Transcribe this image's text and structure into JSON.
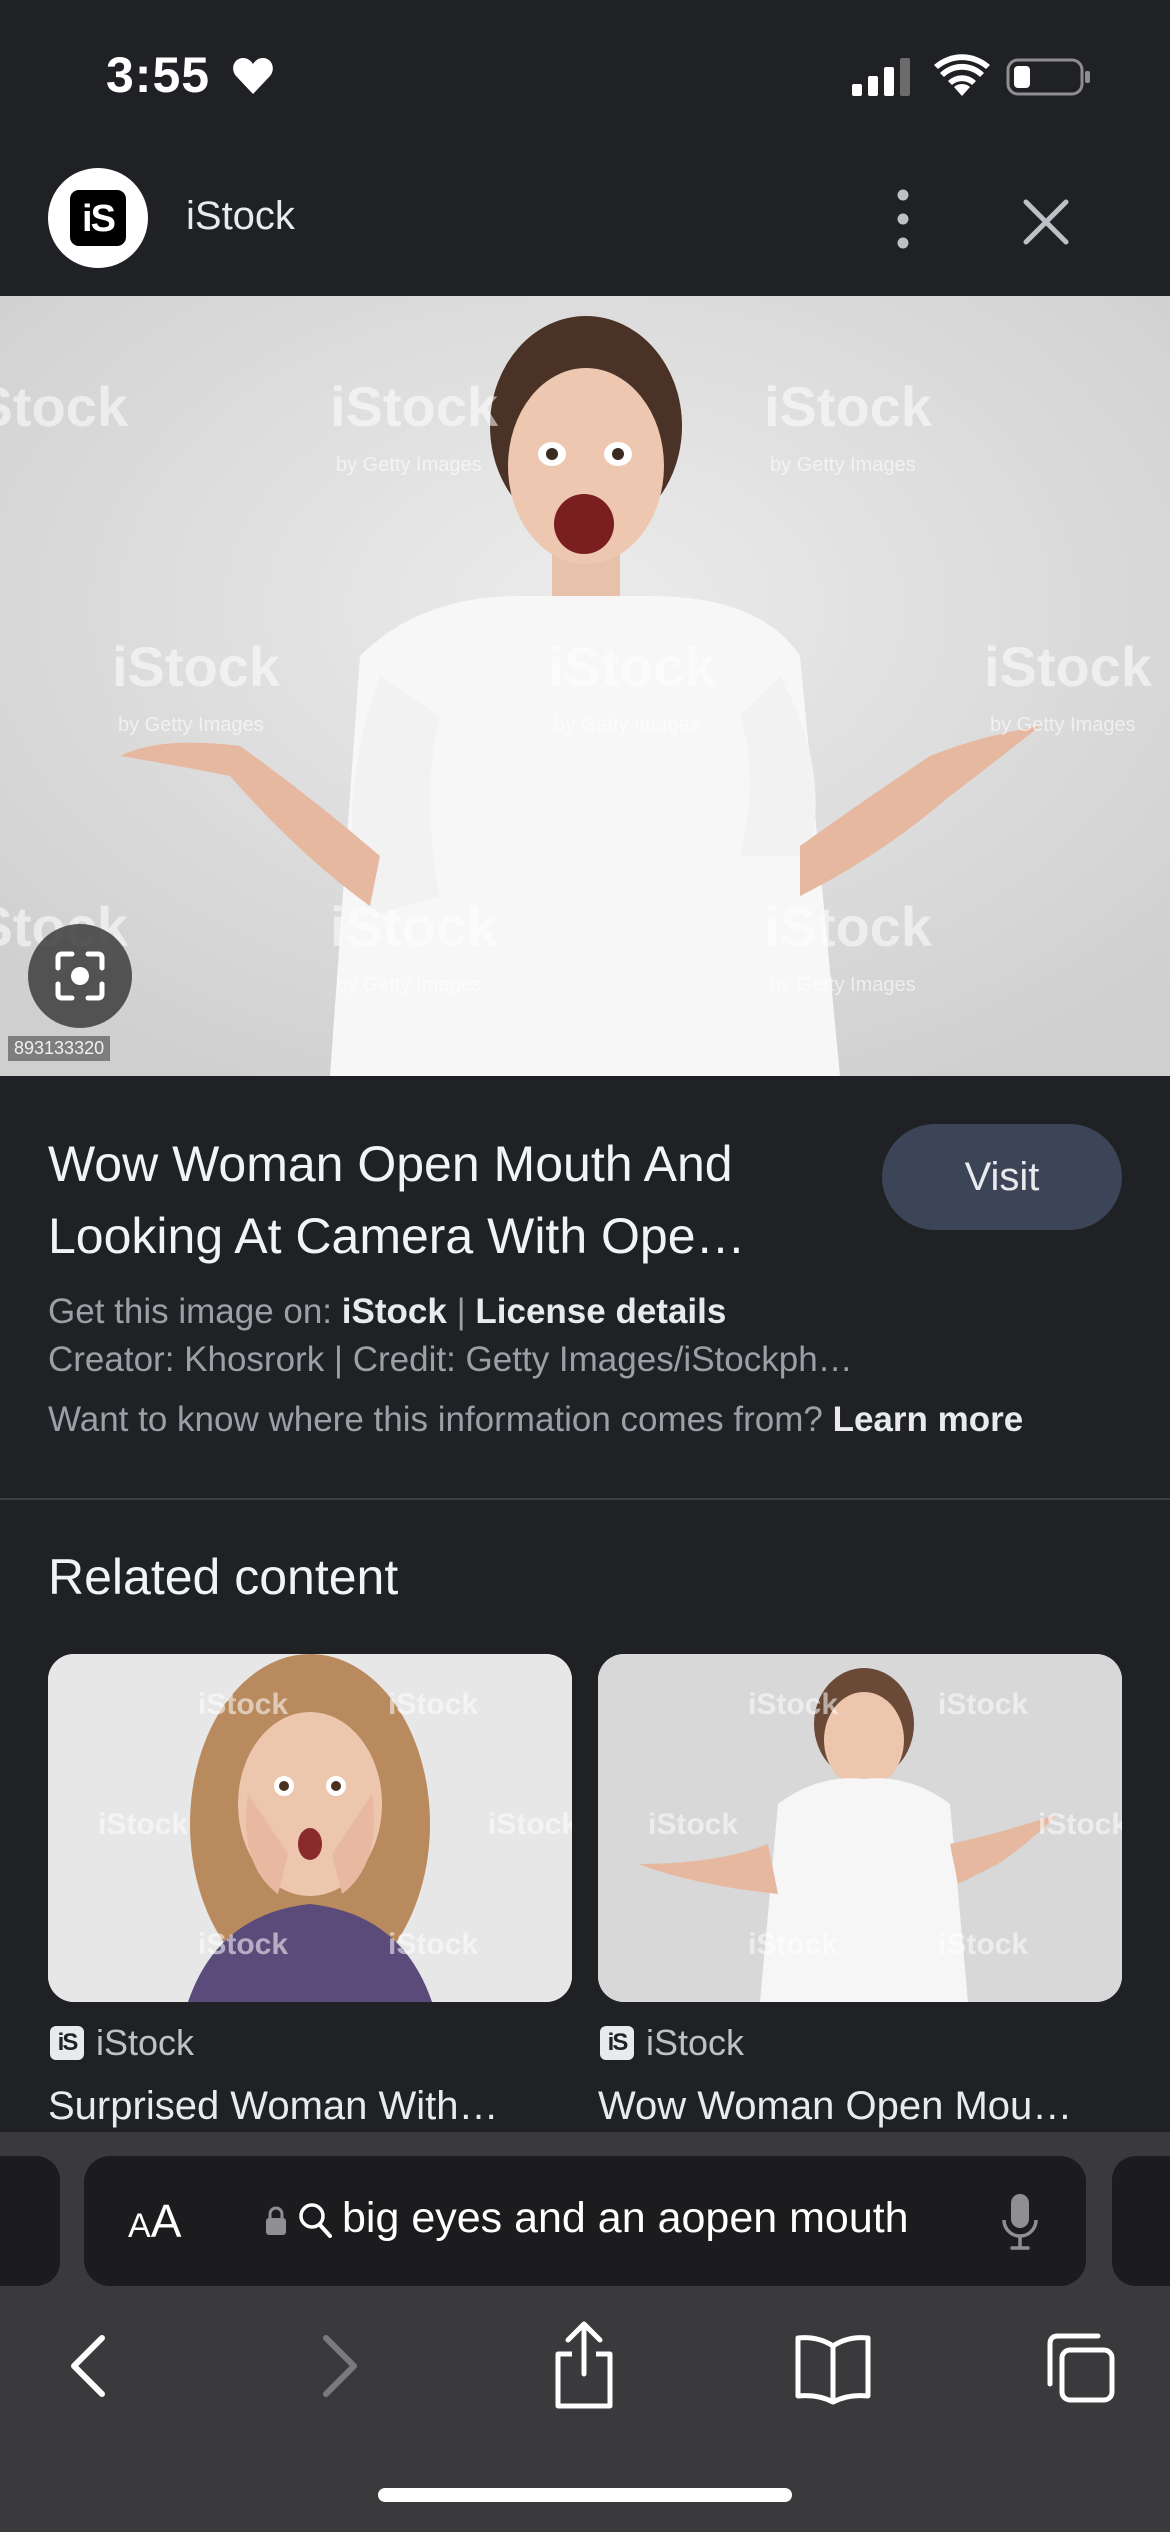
{
  "status_bar": {
    "time": "3:55",
    "icons": [
      "heart-icon",
      "cellular-signal-icon",
      "wifi-icon",
      "battery-icon"
    ]
  },
  "site_header": {
    "logo_text": "iS",
    "site_name": "iStock",
    "icons": [
      "more-vertical-icon",
      "close-icon"
    ]
  },
  "hero_image": {
    "description_icon": "lens-icon",
    "image_id": "893133320",
    "watermark": "iStock",
    "watermark_sub": "by Getty Images"
  },
  "info": {
    "title": "Wow Woman Open Mouth And Looking At Camera With Ope…",
    "visit_label": "Visit",
    "get_image_prefix": "Get this image on:",
    "get_image_source": "iStock",
    "separator": "|",
    "license_label": "License details",
    "creator_line": "Creator: Khosrork | Credit: Getty Images/iStockph…",
    "info_question": "Want to know where this information comes from?",
    "learn_more": "Learn more"
  },
  "related": {
    "heading": "Related content",
    "cards": [
      {
        "source": "iStock",
        "source_icon_text": "iS",
        "title": "Surprised Woman With…"
      },
      {
        "source": "iStock",
        "source_icon_text": "iS",
        "title": "Wow Woman Open Mou…"
      }
    ]
  },
  "browser": {
    "aa_label_small": "A",
    "aa_label_large": "A",
    "url_text": "big eyes and an aopen mouth",
    "nav_icons": [
      "back-icon",
      "forward-icon",
      "share-icon",
      "bookmarks-icon",
      "tabs-icon"
    ]
  },
  "colors": {
    "background": "#202124",
    "visit_button": "#3c4458",
    "chrome": "#3a3a3c",
    "url_bar": "#1c1c1e"
  }
}
